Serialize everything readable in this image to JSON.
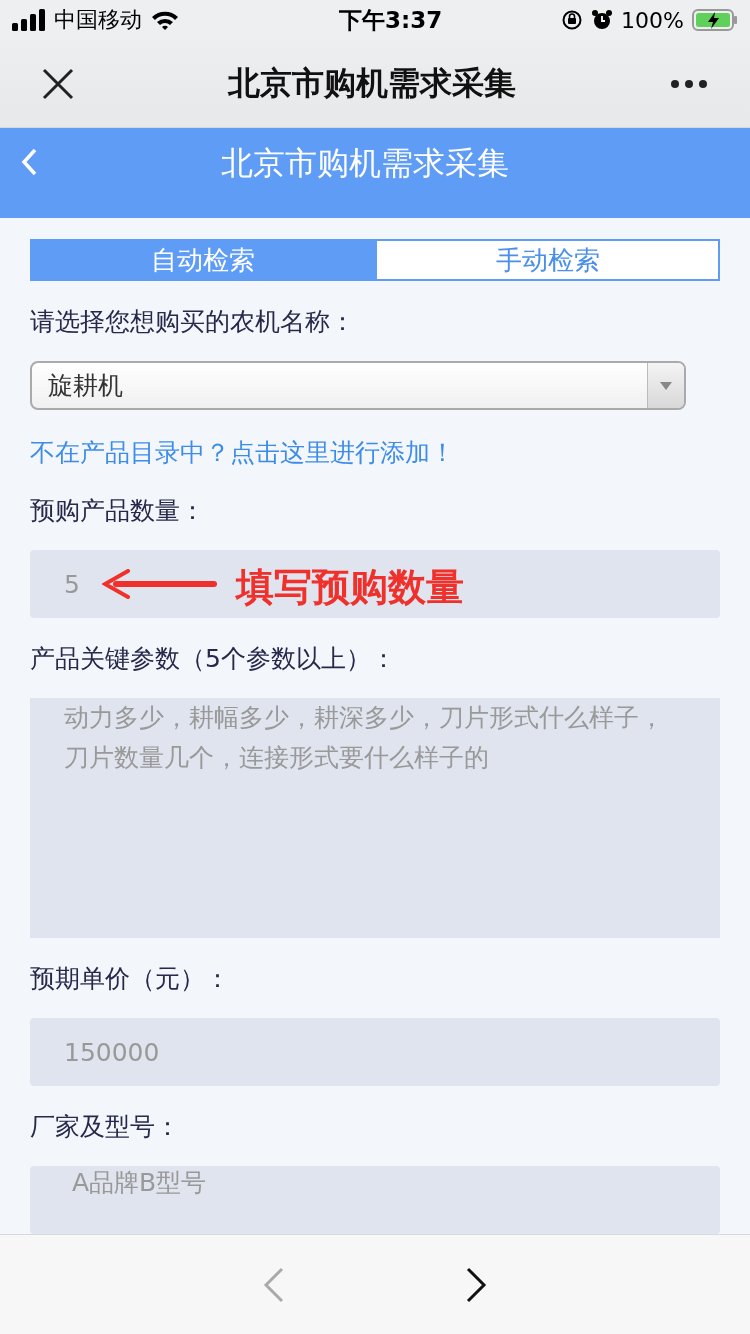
{
  "status_bar": {
    "carrier": "中国移动",
    "time": "下午3:37",
    "battery": "100%"
  },
  "nav_bar": {
    "title": "北京市购机需求采集"
  },
  "header": {
    "title": "北京市购机需求采集"
  },
  "tabs": [
    {
      "label": "自动检索",
      "selected": true
    },
    {
      "label": "手动检索",
      "selected": false
    }
  ],
  "form": [
    {
      "kind": "select",
      "label": "请选择您想购买的农机名称：",
      "value": "旋耕机"
    },
    {
      "kind": "link",
      "text": "不在产品目录中？点击这里进行添加！"
    },
    {
      "kind": "input",
      "label": "预购产品数量：",
      "placeholder": "5",
      "annotation": "填写预购数量"
    },
    {
      "kind": "textarea",
      "label": "产品关键参数（5个参数以上）：",
      "placeholder": "动力多少，耕幅多少，耕深多少，刀片形式什么样子，刀片数量几个，连接形式要什么样子的"
    },
    {
      "kind": "input",
      "label": "预期单价（元）：",
      "placeholder": "150000"
    },
    {
      "kind": "input",
      "label": "厂家及型号：",
      "placeholder": "A品牌B型号",
      "cut": true
    }
  ],
  "toolbar": {
    "back_disabled": true,
    "forward_disabled": false
  }
}
